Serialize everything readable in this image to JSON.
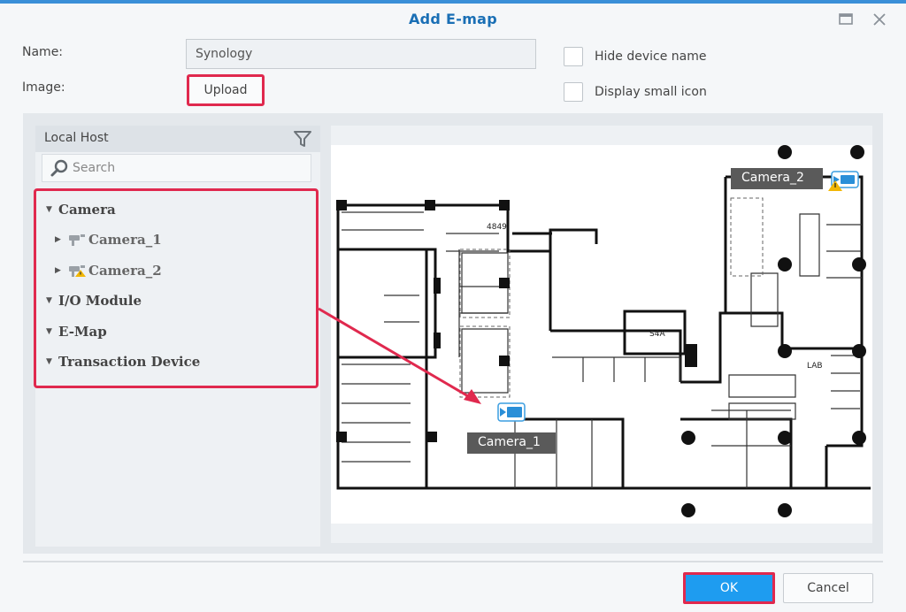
{
  "dialog": {
    "title": "Add E-map"
  },
  "form": {
    "name_label": "Name:",
    "name_value": "Synology",
    "image_label": "Image:",
    "upload_label": "Upload",
    "hide_device_name_label": "Hide device name",
    "hide_device_name_checked": false,
    "display_small_icon_label": "Display small icon",
    "display_small_icon_checked": false
  },
  "device_tree": {
    "host_label": "Local Host",
    "search_placeholder": "Search",
    "items": [
      {
        "label": "Camera",
        "level": 0,
        "expanded": true
      },
      {
        "label": "Camera_1",
        "level": 1,
        "expanded": false,
        "icon": "camera-icon"
      },
      {
        "label": "Camera_2",
        "level": 1,
        "expanded": false,
        "icon": "camera-warning-icon"
      },
      {
        "label": "I/O Module",
        "level": 0,
        "expanded": true
      },
      {
        "label": "E-Map",
        "level": 0,
        "expanded": true
      },
      {
        "label": "Transaction Device",
        "level": 0,
        "expanded": true
      }
    ]
  },
  "map": {
    "room_labels": [
      "4849",
      "S4A",
      "LAB"
    ],
    "cameras": [
      {
        "label": "Camera_1",
        "warning": false
      },
      {
        "label": "Camera_2",
        "warning": true
      }
    ]
  },
  "footer": {
    "ok_label": "OK",
    "cancel_label": "Cancel"
  },
  "colors": {
    "accent": "#1e9cf0",
    "highlight": "#e0294e",
    "title": "#1a6fb5"
  }
}
